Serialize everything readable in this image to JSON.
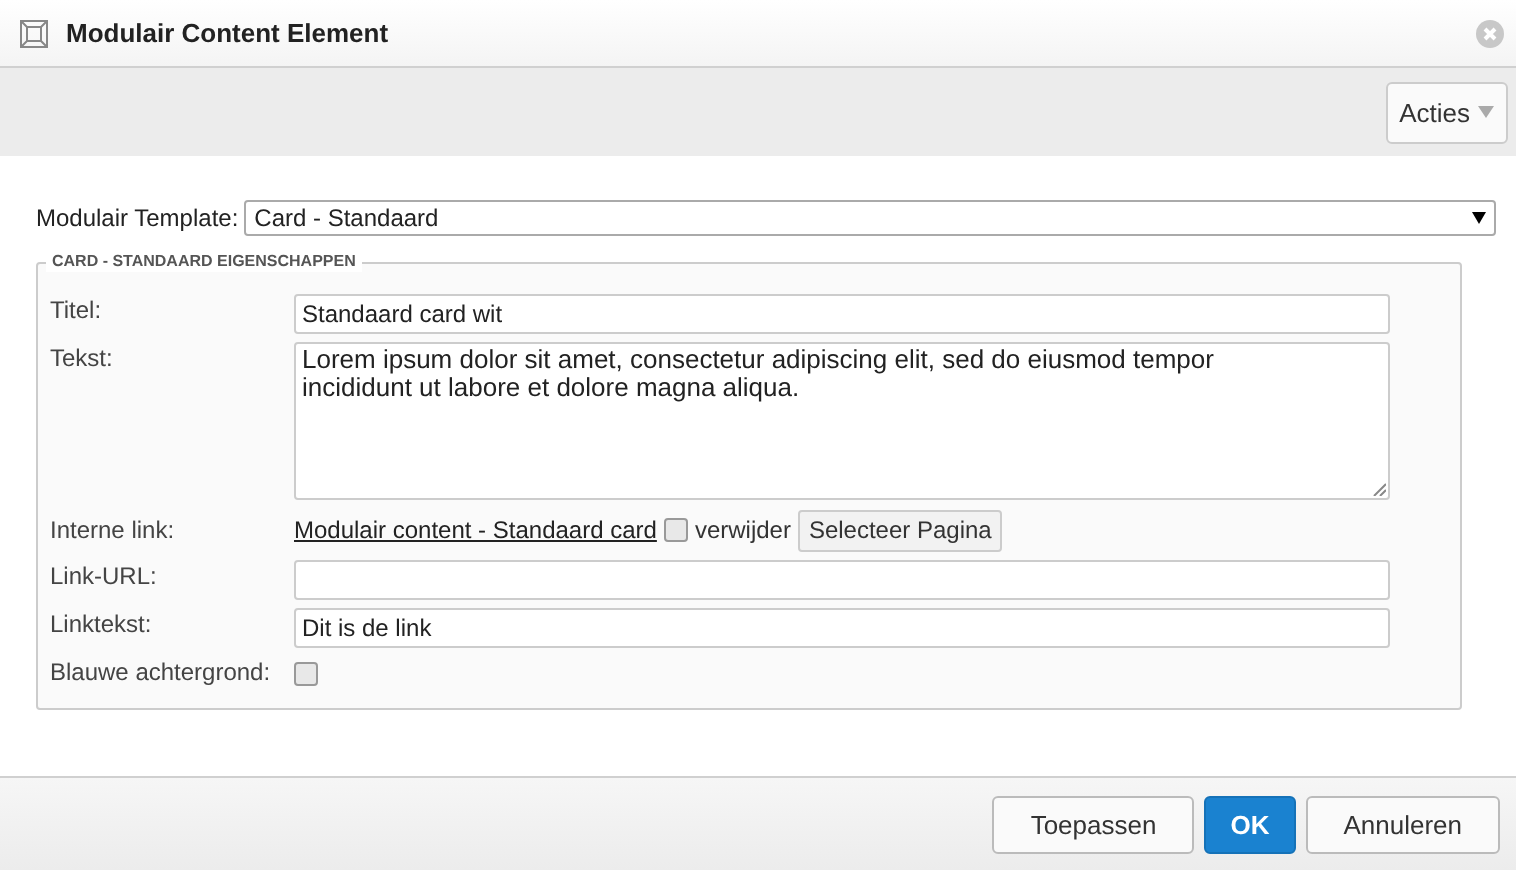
{
  "window": {
    "title": "Modulair Content Element"
  },
  "toolbar": {
    "actions_button": "Acties"
  },
  "template": {
    "label": "Modulair Template:",
    "value": "Card - Standaard"
  },
  "fieldset": {
    "legend": "CARD - STANDAARD EIGENSCHAPPEN",
    "rows": [
      {
        "kind": "input",
        "label": "Titel:",
        "value": "Standaard card wit"
      },
      {
        "kind": "textarea",
        "label": "Tekst:",
        "value": "Lorem ipsum dolor sit amet, consectetur adipiscing elit, sed do eiusmod tempor incididunt ut labore et dolore magna aliqua."
      },
      {
        "kind": "link",
        "label": "Interne link:",
        "link": "Modulair content - Standaard card",
        "checkbox_label": "verwijder",
        "checked": false,
        "button": "Selecteer Pagina"
      },
      {
        "kind": "input",
        "label": "Link-URL:",
        "value": ""
      },
      {
        "kind": "input",
        "label": "Linktekst:",
        "value": "Dit is de link"
      },
      {
        "kind": "checkbox",
        "label": "Blauwe achtergrond:",
        "checked": false
      }
    ]
  },
  "buttons": [
    {
      "label": "Toepassen",
      "primary": false
    },
    {
      "label": "OK",
      "primary": true
    },
    {
      "label": "Annuleren",
      "primary": false
    }
  ]
}
